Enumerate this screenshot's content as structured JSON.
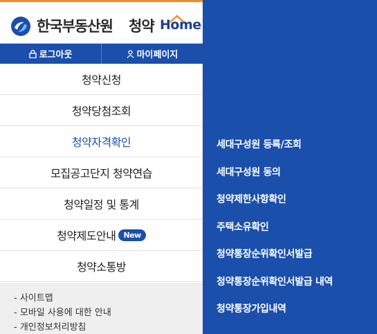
{
  "brand": {
    "name": "한국부동산원",
    "service_name": "청약",
    "home_text": "Home",
    "accent": "#1a4fab",
    "highlight": "#f08b2b"
  },
  "top_buttons": {
    "logout_label": "로그아웃",
    "logout_icon": "lock-icon",
    "mypage_label": "마이페이지",
    "mypage_icon": "person-icon"
  },
  "menu": {
    "items": [
      {
        "label": "청약신청"
      },
      {
        "label": "청약당첨조회"
      },
      {
        "label": "청약자격확인",
        "active": true
      },
      {
        "label": "모집공고단지 청약연습"
      },
      {
        "label": "청약일정 및 통계"
      },
      {
        "label": "청약제도안내",
        "badge": "New"
      },
      {
        "label": "청약소통방"
      }
    ]
  },
  "footer": {
    "links": [
      {
        "label": "- 사이트맵"
      },
      {
        "label": "- 모바일 사용에 대한 안내"
      },
      {
        "label": "- 개인정보처리방침"
      }
    ]
  },
  "submenu": {
    "items": [
      {
        "label": "세대구성원 등록/조회"
      },
      {
        "label": "세대구성원 동의"
      },
      {
        "label": "청약제한사항확인"
      },
      {
        "label": "주택소유확인"
      },
      {
        "label": "청약통장순위확인서발급"
      },
      {
        "label": "청약통장순위확인서발급 내역"
      },
      {
        "label": "청약통장가입내역"
      }
    ]
  }
}
